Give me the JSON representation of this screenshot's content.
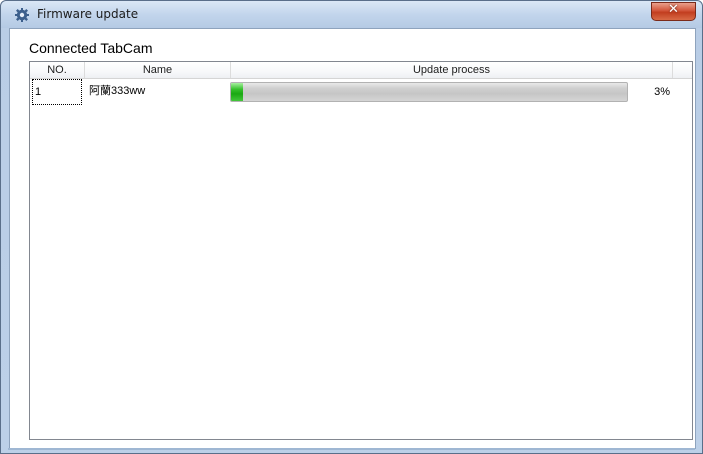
{
  "window": {
    "title": "Firmware update",
    "close_glyph": "✕"
  },
  "group": {
    "label": "Connected TabCam"
  },
  "table": {
    "columns": [
      "NO.",
      "Name",
      "Update process"
    ],
    "rows": [
      {
        "no": "1",
        "name": "阿蘭333ww",
        "progress_percent": 3,
        "progress_text": "3%"
      }
    ]
  },
  "colors": {
    "progress_green": "#22b01a",
    "close_red": "#c23d1f"
  },
  "icons": {
    "app": "gear-icon",
    "close": "close-icon"
  }
}
